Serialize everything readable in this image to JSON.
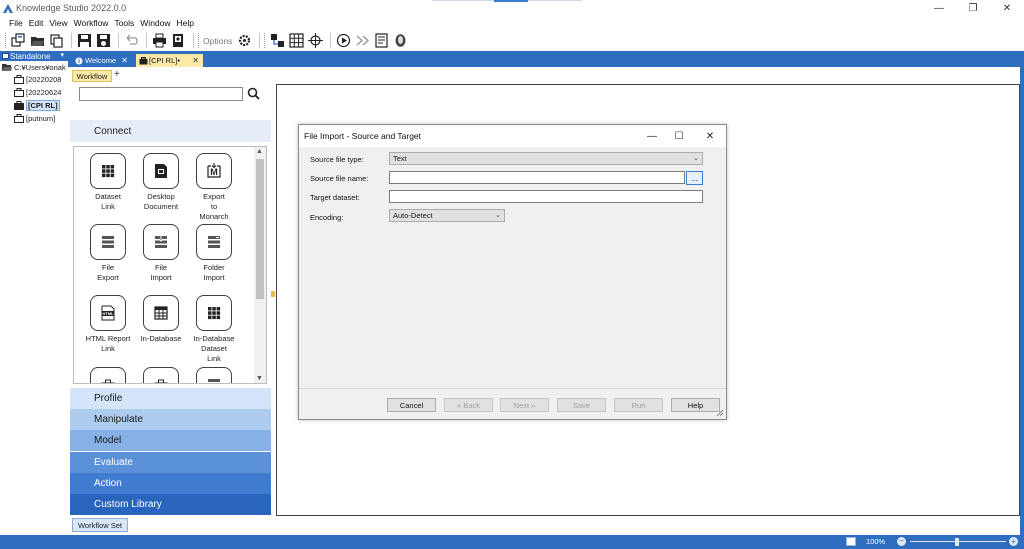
{
  "window": {
    "title": "Knowledge Studio 2022.0.0",
    "minimize": "—",
    "maximize": "❐",
    "close": "✕"
  },
  "menu": [
    "File",
    "Edit",
    "View",
    "Workflow",
    "Tools",
    "Window",
    "Help"
  ],
  "toolbar": {
    "options_label": "Options"
  },
  "tree": {
    "header": "Standalone",
    "pin": "▾",
    "root": "C:¥Users¥onak",
    "items": [
      "[20220208",
      "[20220624",
      "[CPI RL]",
      "[putnum]"
    ],
    "selected_index": 2
  },
  "tabs": {
    "welcome": "Welcome",
    "cpi": "[CPI RL]•",
    "close": "✕"
  },
  "workflow": {
    "sub_tab": "Workflow",
    "add": "+",
    "search_placeholder": ""
  },
  "palette": {
    "connect": "Connect",
    "tools": [
      {
        "label": "Dataset\nLink",
        "icon": "grid-icon"
      },
      {
        "label": "Desktop\nDocument",
        "icon": "document-icon"
      },
      {
        "label": "Export\nto\nMonarch",
        "icon": "monarch-icon"
      },
      {
        "label": "File\nExport",
        "icon": "file-export-icon"
      },
      {
        "label": "File\nImport",
        "icon": "file-import-icon"
      },
      {
        "label": "Folder\nImport",
        "icon": "folder-import-icon"
      },
      {
        "label": "HTML Report\nLink",
        "icon": "html-icon"
      },
      {
        "label": "In-Database",
        "icon": "calculator-icon"
      },
      {
        "label": "In-Database\nDataset\nLink",
        "icon": "grid-icon"
      }
    ],
    "categories": [
      {
        "label": "Profile",
        "bg": "#d4e5fa",
        "fg": "#1b1b1b"
      },
      {
        "label": "Manipulate",
        "bg": "#aecbf0",
        "fg": "#1b1b1b"
      },
      {
        "label": "Model",
        "bg": "#86b0e6",
        "fg": "#1b1b1b"
      },
      {
        "label": "Evaluate",
        "bg": "#5b91d9",
        "fg": "#ffffff"
      },
      {
        "label": "Action",
        "bg": "#3f7ccf",
        "fg": "#ffffff"
      },
      {
        "label": "Custom Library",
        "bg": "#2a65bd",
        "fg": "#ffffff"
      }
    ],
    "workflow_set": "Workflow Set"
  },
  "dialog": {
    "title": "File Import - Source and Target",
    "minimize": "—",
    "maximize": "☐",
    "close": "✕",
    "source_type_label": "Source file type:",
    "source_type_value": "Text",
    "source_name_label": "Source file name:",
    "source_name_value": "",
    "browse": "...",
    "target_label": "Target dataset:",
    "target_value": "",
    "encoding_label": "Encoding:",
    "encoding_value": "Auto-Detect",
    "buttons": {
      "cancel": "Cancel",
      "back": "« Back",
      "next": "Next »",
      "save": "Save",
      "run": "Run",
      "help": "Help"
    }
  },
  "status": {
    "zoom": "100%",
    "minus": "−",
    "plus": "+"
  },
  "colors": {
    "accent": "#2e6dbf",
    "tab_active": "#fbe9a8"
  }
}
